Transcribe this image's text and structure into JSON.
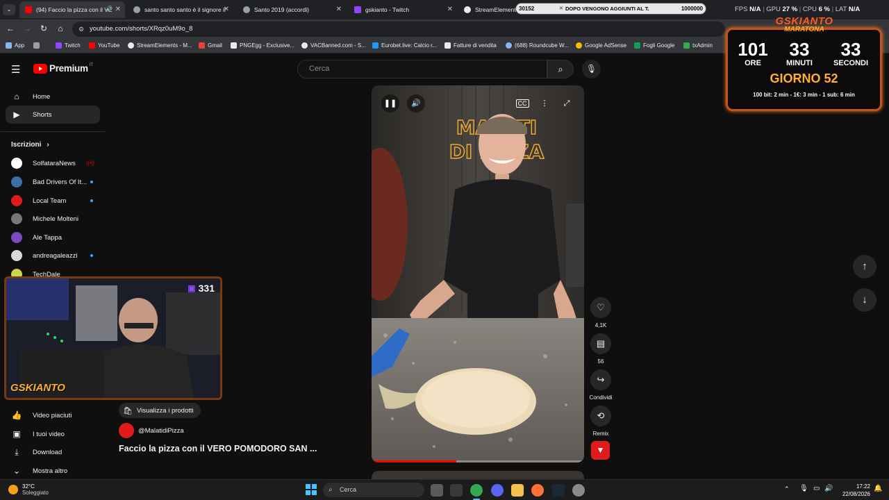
{
  "browser": {
    "tabs": [
      {
        "title": "(94) Faccio la pizza con il VE",
        "icon": "youtube-icon",
        "color": "#ff0000"
      },
      {
        "title": "santo santo santo è il signore il",
        "icon": "google-icon",
        "color": "#9aa0a6"
      },
      {
        "title": "Santo 2019 (accordi)",
        "icon": "globe-icon",
        "color": "#9aa0a6"
      },
      {
        "title": "gskianto - Twitch",
        "icon": "twitch-icon",
        "color": "#9146ff"
      },
      {
        "title": "StreamElements",
        "icon": "streamelements-icon",
        "color": "#e8eaed"
      }
    ],
    "url": "youtube.com/shorts/XRqz0uM9o_8",
    "bookmarks": [
      {
        "label": "App",
        "color": "#8ab4f8"
      },
      {
        "label": "Twitch",
        "color": "#9146ff"
      },
      {
        "label": "YouTube",
        "color": "#ff0000"
      },
      {
        "label": "StreamElements - M...",
        "color": "#e8eaed"
      },
      {
        "label": "Gmail",
        "color": "#ea4335"
      },
      {
        "label": "PNGEgg - Exclusive...",
        "color": "#e8eaed"
      },
      {
        "label": "VACBanned.com - S...",
        "color": "#e8eaed"
      },
      {
        "label": "Eurobet.live: Calcio r...",
        "color": "#2196f3"
      },
      {
        "label": "Fatture di vendita",
        "color": "#e8eaed"
      },
      {
        "label": "(688) Roundcube W...",
        "color": "#8ab4f8"
      },
      {
        "label": "Google AdSense",
        "color": "#fbbc04"
      },
      {
        "label": "Fogli Google",
        "color": "#0f9d58"
      },
      {
        "label": "txAdmin",
        "color": "#34a853"
      }
    ]
  },
  "youtube": {
    "brand": "Premium",
    "region": "IT",
    "search_placeholder": "Cerca",
    "nav": [
      {
        "label": "Home",
        "icon": "home-icon"
      },
      {
        "label": "Shorts",
        "icon": "shorts-icon"
      }
    ],
    "subscriptions_title": "Iscrizioni",
    "subscriptions": [
      {
        "name": "SolfataraNews",
        "color": "#ffffff",
        "badge": "live"
      },
      {
        "name": "Bad Drivers Of It...",
        "color": "#3a6ea5",
        "badge": "dot"
      },
      {
        "name": "Local Team",
        "color": "#e01b1b",
        "badge": "dot"
      },
      {
        "name": "Michele Molteni",
        "color": "#777777",
        "badge": ""
      },
      {
        "name": "Ale Tappa",
        "color": "#7b4cbd",
        "badge": ""
      },
      {
        "name": "andreagaleazzi",
        "color": "#d9d9d9",
        "badge": "dot"
      },
      {
        "name": "TechDale",
        "color": "#c8d84a",
        "badge": ""
      }
    ],
    "lower_nav": [
      {
        "label": "Video piaciuti",
        "icon": "thumbs-up-icon"
      },
      {
        "label": "I tuoi video",
        "icon": "play-square-icon"
      },
      {
        "label": "Download",
        "icon": "download-icon"
      },
      {
        "label": "Mostra altro",
        "icon": "chevron-down-icon"
      }
    ],
    "short": {
      "products_button": "Visualizza i prodotti",
      "channel": "@MalatidiPizza",
      "title": "Faccio la pizza con il VERO POMODORO SAN ...",
      "likes": "4,1K",
      "comments": "56",
      "share_label": "Condividi",
      "remix_label": "Remix",
      "progress": 0.4
    }
  },
  "overlays": {
    "ticker": {
      "count": "30152",
      "text": "DOPO VENGONO AGGIUNTI AL T.",
      "goal": "1000000"
    },
    "hw_stats": [
      {
        "label": "FPS",
        "value": "N/A"
      },
      {
        "label": "GPU",
        "value": "27 %"
      },
      {
        "label": "CPU",
        "value": "6 %"
      },
      {
        "label": "LAT",
        "value": "N/A"
      }
    ],
    "timer": {
      "title": "GSKIANTO",
      "subtitle": "MARATONA",
      "hours": "101",
      "minutes": "33",
      "seconds": "33",
      "hours_label": "ORE",
      "minutes_label": "MINUTI",
      "seconds_label": "SECONDI",
      "day": "GIORNO 52",
      "rules": "100 bit: 2 min - 1€: 3 min - 1 sub: 6 min"
    },
    "webcam": {
      "viewers": "331",
      "logo": "GSKIANTO"
    }
  },
  "taskbar": {
    "weather_temp": "32°C",
    "weather_desc": "Soleggiato",
    "search_placeholder": "Cerca",
    "time": "17:22",
    "date": "22/08/2026"
  }
}
